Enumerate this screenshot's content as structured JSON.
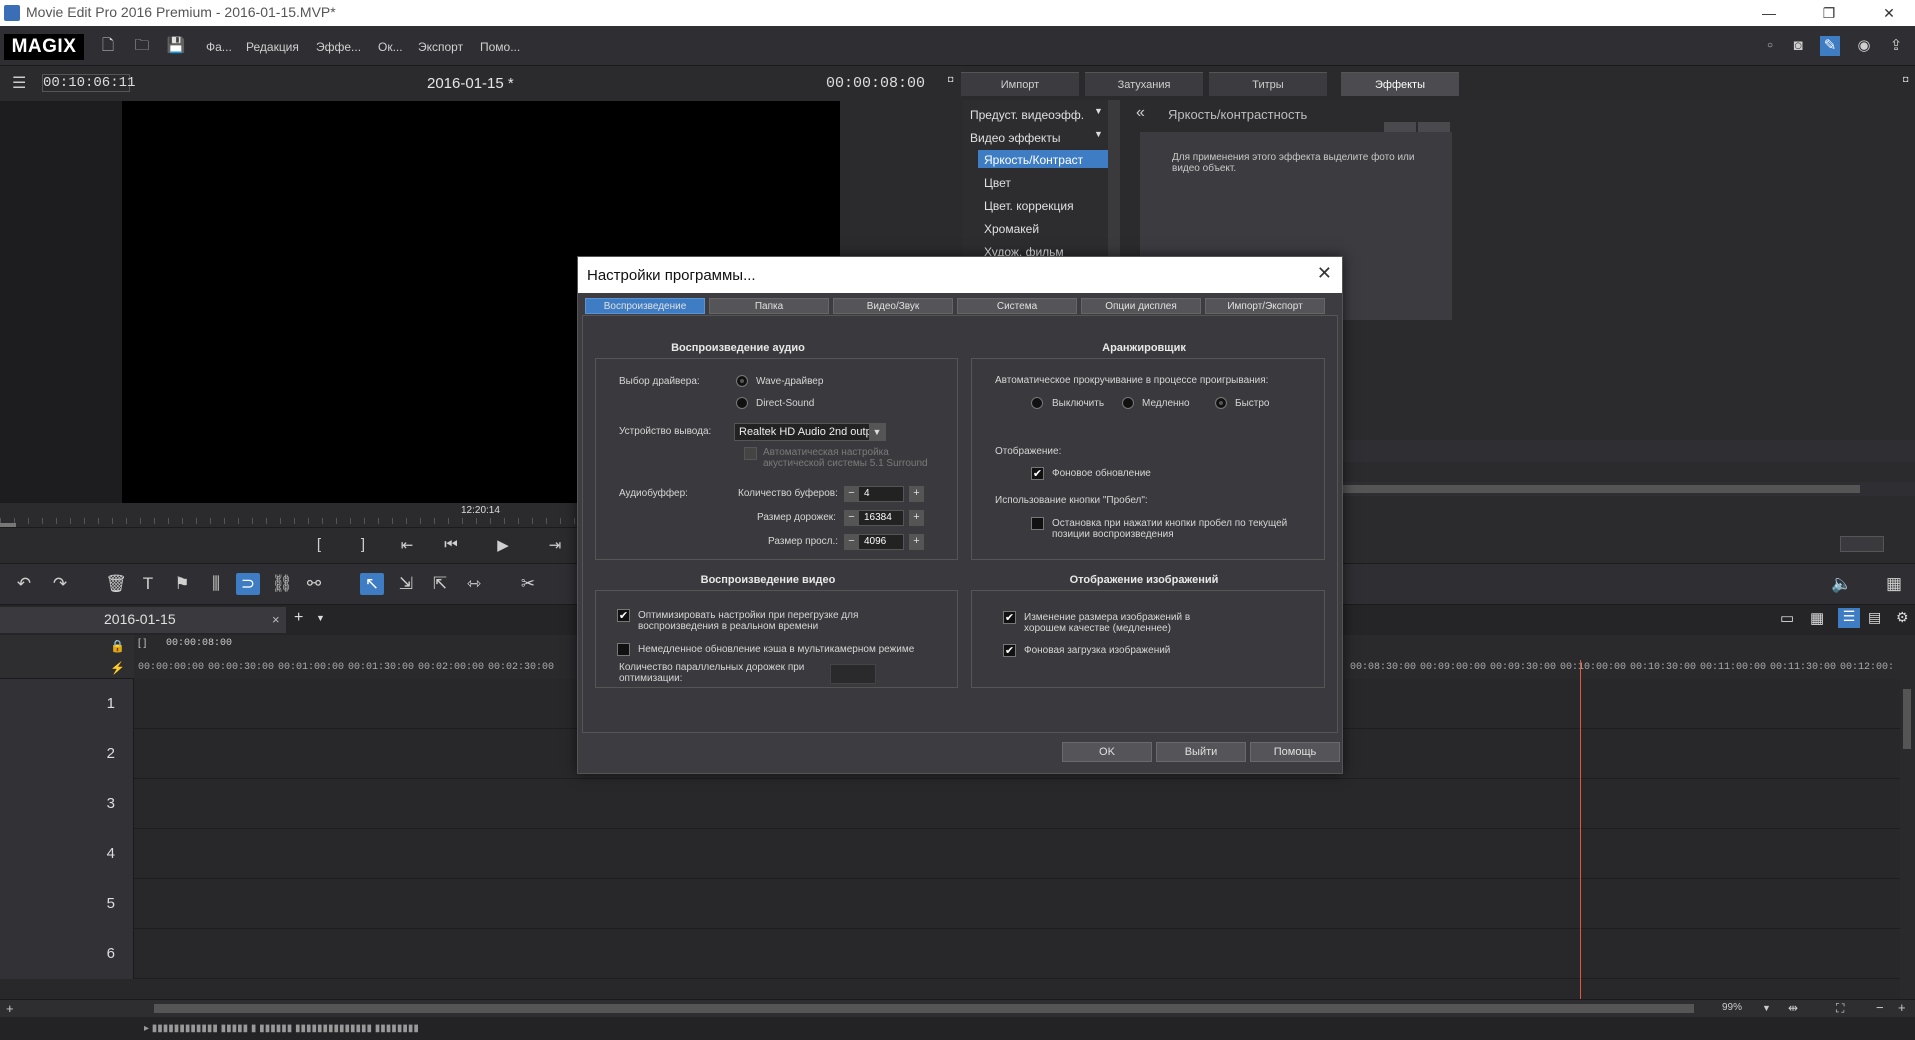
{
  "window": {
    "title": "Movie Edit Pro 2016 Premium - 2016-01-15.MVP*",
    "minimize": "—",
    "restore": "❐",
    "close": "✕"
  },
  "menubar": {
    "logo": "MAGIX",
    "items": [
      "Фа...",
      "Редакция",
      "Эффе...",
      "Ок...",
      "Экспорт",
      "Помо..."
    ]
  },
  "preview": {
    "timecode": "00:10:06:11",
    "project_title": "2016-01-15 *",
    "duration": "00:00:08:00",
    "scrub_time": "12:20:14"
  },
  "right_panel": {
    "tabs": [
      "Импорт",
      "Затухания",
      "Титры",
      "Эффекты"
    ],
    "active_tab": "Эффекты",
    "presets_label": "Предуст. видеоэфф.",
    "video_effects_label": "Видео эффекты",
    "effect_items": [
      "Яркость/Контраст",
      "Цвет",
      "Цвет. коррекция",
      "Хромакей",
      "Худож. фильм"
    ],
    "selected_effect": "Яркость/Контраст",
    "detail_title": "Яркость/контрастность",
    "detail_hint": "Для применения этого эффекта выделите фото или видео объект."
  },
  "timeline": {
    "tab_label": "2016-01-15",
    "ruler_top_time": "00:00:08:00",
    "ruler_labels_left": [
      "00:00:00:00",
      "00:00:30:00",
      "00:01:00:00",
      "00:01:30:00",
      "00:02:00:00",
      "00:02:30:00"
    ],
    "ruler_labels_right": [
      "00:08:30:00",
      "00:09:00:00",
      "00:09:30:00",
      "00:10:00:00",
      "00:10:30:00",
      "00:11:00:00",
      "00:11:30:00",
      "00:12:00:"
    ],
    "tracks": [
      "1",
      "2",
      "3",
      "4",
      "5",
      "6"
    ],
    "zoom": "99%",
    "status": "▸ ▮▮▮▮▮▮▮▮▮▮▮▮ ▮▮▮▮▮ ▮ ▮▮▮▮▮▮ ▮▮▮▮▮▮▮▮▮▮▮▮▮▮ ▮▮▮▮▮▮▮▮"
  },
  "dialog": {
    "title": "Настройки программы...",
    "close": "✕",
    "tabs": [
      "Воспроизведение",
      "Папка",
      "Видео/Звук",
      "Система",
      "Опции дисплея",
      "Импорт/Экспорт"
    ],
    "active_tab": "Воспроизведение",
    "audio": {
      "section_title": "Воспроизведение аудио",
      "driver_label": "Выбор драйвера:",
      "driver_options": [
        "Wave-драйвер",
        "Direct-Sound"
      ],
      "selected_driver": "Wave-драйвер",
      "output_label": "Устройство вывода:",
      "output_value": "Realtek HD Audio 2nd outp...",
      "auto_surround_label": "Автоматическая настройка акустической системы 5.1 Surround",
      "buffer_label": "Аудиобуффер:",
      "buffer_count_label": "Количество буферов:",
      "buffer_count": "4",
      "track_size_label": "Размер дорожек:",
      "track_size": "16384",
      "preview_size_label": "Размер просл.:",
      "preview_size": "4096"
    },
    "arranger": {
      "section_title": "Аранжировщик",
      "autoscroll_label": "Автоматическое прокручивание в процессе проигрывания:",
      "scroll_options": [
        "Выключить",
        "Медленно",
        "Быстро"
      ],
      "selected_scroll": "Быстро",
      "display_label": "Отображение:",
      "bg_update_label": "Фоновое обновление",
      "bg_update_checked": true,
      "space_label": "Использование кнопки \"Пробел\":",
      "space_stop_label": "Остановка при нажатии кнопки пробел по текущей позиции воспроизведения",
      "space_stop_checked": false
    },
    "video": {
      "section_title": "Воспроизведение видео",
      "optimize_label": "Оптимизировать настройки при перегрузке для воспроизведения в реальном времени",
      "optimize_checked": true,
      "multicam_label": "Немедленное обновление кэша в мультикамерном режиме",
      "multicam_checked": false,
      "parallel_label": "Количество параллельных дорожек при оптимизации:"
    },
    "images": {
      "section_title": "Отображение изображений",
      "hq_resize_label": "Изменение размера изображений в хорошем качестве (медленнее)",
      "hq_resize_checked": true,
      "bg_load_label": "Фоновая загрузка изображений",
      "bg_load_checked": true
    },
    "buttons": {
      "ok": "OK",
      "exit": "Выйти",
      "help": "Помощь"
    }
  },
  "colors": {
    "accent": "#3e7dc4",
    "playhead": "#e05a3a",
    "background": "#2b2b2e"
  }
}
